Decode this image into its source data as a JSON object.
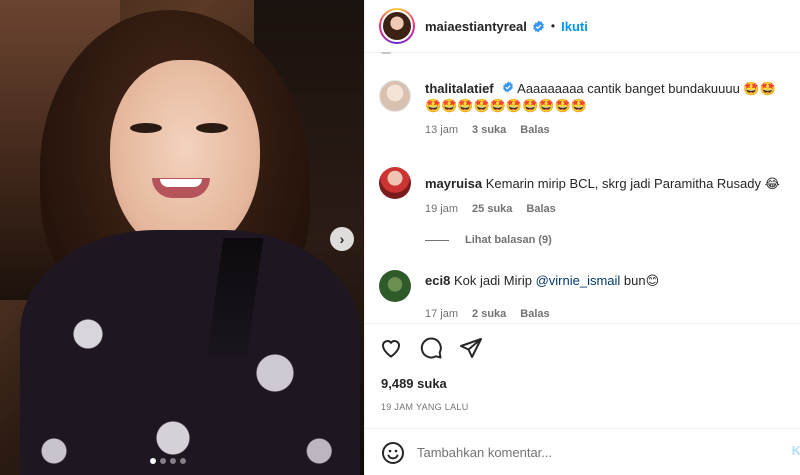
{
  "photo": {
    "carousel_next_label": "›",
    "dots_total": 4,
    "dots_active": 1
  },
  "header": {
    "username": "maiaestiantyreal",
    "separator": "•",
    "follow_label": "Ikuti"
  },
  "comments": [
    {
      "user": "thalitalatief",
      "text": "Aaaaaaaaa cantik banget bundakuuuu 🤩🤩🤩🤩🤩🤩🤩🤩🤩🤩🤩🤩",
      "time": "13 jam",
      "likes": "3 suka",
      "reply": "Balas"
    },
    {
      "user": "mayruisa",
      "text": "Kemarin mirip BCL, skrg jadi Paramitha Rusady 😂",
      "time": "19 jam",
      "likes": "25 suka",
      "reply": "Balas"
    },
    {
      "user": "eci8",
      "text_before": "Kok jadi Mirip ",
      "mention": "@virnie_ismail",
      "text_after": " bun😊",
      "time": "17 jam",
      "likes": "2 suka",
      "reply": "Balas"
    }
  ],
  "view_replies": "Lihat balasan (9)",
  "likes_count": "9,489 suka",
  "timestamp": "19 JAM YANG LALU",
  "add_comment": {
    "placeholder": "Tambahkan komentar...",
    "post_label": "K"
  },
  "colors": {
    "link_blue": "#0095f6",
    "verified_blue": "#3897f0",
    "muted": "#737373"
  }
}
